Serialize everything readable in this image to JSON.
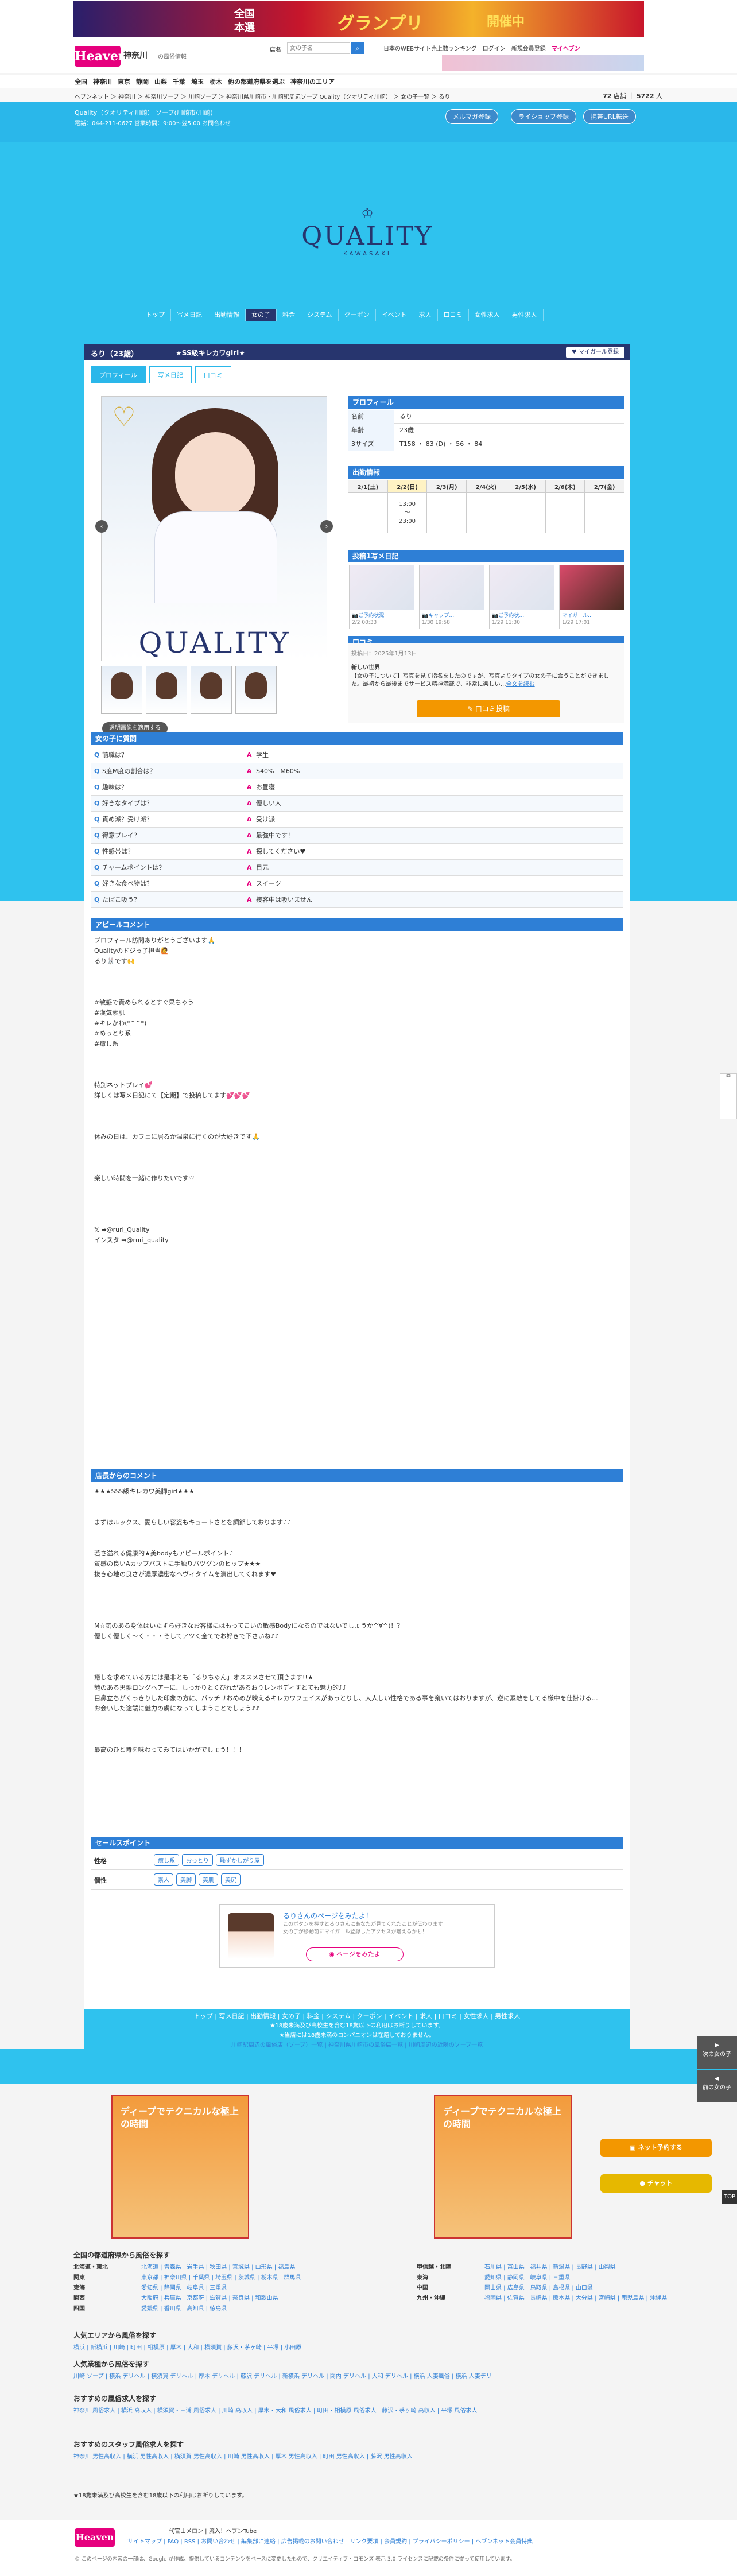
{
  "top_banner": {
    "text1": "全国",
    "text2": "本選",
    "text3": "グランプリ",
    "text4": "開催中"
  },
  "header": {
    "logo": "Heaven",
    "region": "神奈川",
    "region_sub": "の風俗情報",
    "search_placeholder": "女の子名",
    "search_label": "店名",
    "links": [
      "日本のWEBサイト売上数ランキング",
      "ログイン",
      "新規会員登録",
      "マイヘブン"
    ]
  },
  "nav": [
    "全国",
    "神奈川",
    "東京",
    "静岡",
    "山梨",
    "千葉",
    "埼玉",
    "栃木",
    "他の都道府県を選ぶ",
    "神奈川のエリア"
  ],
  "breadcrumb": "ヘブンネット ＞ 神奈川 ＞ 神奈川ソープ ＞ 川崎ソープ ＞ 神奈川県川崎市・川崎駅周辺ソープ Quality（クオリティ川崎） ＞ 女の子一覧 ＞ るり",
  "crumb_right": {
    "a": "72",
    "a_label": "店舗",
    "b": "5722",
    "b_label": "人"
  },
  "shop_bar": {
    "title": "Quality（クオリティ川崎） ソープ(川崎市/川崎)",
    "info": "電話：044-211-0627  営業時間：9:00〜翌5:00  お問合わせ",
    "pills": [
      "メルマガ登録",
      "ライショップ登録",
      "携帯URL転送"
    ]
  },
  "hero": {
    "logo": "QUALITY",
    "logo_sub": "KAWASAKI"
  },
  "shop_nav": [
    "トップ",
    "写メ日記",
    "出勤情報",
    "女の子",
    "料金",
    "システム",
    "クーポン",
    "イベント",
    "求人",
    "口コミ",
    "女性求人",
    "男性求人"
  ],
  "profile": {
    "name": "るり（23歳）",
    "tagline": "★SS級キレカワgirl★",
    "my_girl_btn": "マイガール登録",
    "tabs": [
      "プロフィール",
      "写メ日記",
      "口コミ"
    ],
    "photo_watermark": "QUALITY",
    "grad_btn": "透明画像を適用する",
    "prev": "‹",
    "next": "›"
  },
  "prof_table": {
    "header": "プロフィール",
    "rows": [
      {
        "k": "名前",
        "v": "るり"
      },
      {
        "k": "年齢",
        "v": "23歳"
      },
      {
        "k": "3サイズ",
        "v": "T158 ・ 83 (D) ・ 56 ・ 84"
      }
    ]
  },
  "schedule": {
    "header": "出勤情報",
    "days": [
      "2/1(土)",
      "2/2(日)",
      "2/3(月)",
      "2/4(火)",
      "2/5(水)",
      "2/6(木)",
      "2/7(金)"
    ],
    "times": [
      "",
      "13:00\n〜\n23:00",
      "",
      "",
      "",
      "",
      ""
    ]
  },
  "diary": {
    "header": "投稿1写メ日記",
    "items": [
      {
        "title": "📷ご予約状況",
        "date": "2/2 00:33"
      },
      {
        "title": "📷キャップ…",
        "date": "1/30 19:58"
      },
      {
        "title": "📷ご予約状…",
        "date": "1/29 11:30"
      },
      {
        "title": "マイガール…",
        "date": "1/29 17:01"
      }
    ]
  },
  "kuchikomi": {
    "header": "口コミ",
    "date": "投稿日：2025年1月13日",
    "title": "新しい世界",
    "body": "【女の子について】写真を見て指名をしたのですが、写真よりタイプの女の子に会うことができました。最初から最後までサービス精神満載で、非常に楽しい…",
    "more": "全文を読む",
    "post_btn": "口コミ投稿"
  },
  "qa": {
    "header": "女の子に質問",
    "items": [
      {
        "q": "前職は？",
        "a": "学生"
      },
      {
        "q": "S度M度の割合は？",
        "a": "S40%　M60%"
      },
      {
        "q": "趣味は？",
        "a": "お昼寝"
      },
      {
        "q": "好きなタイプは？",
        "a": "優しい人"
      },
      {
        "q": "責め派？受け派？",
        "a": "受け派"
      },
      {
        "q": "得意プレイ？",
        "a": "最強中です！"
      },
      {
        "q": "性感帯は？",
        "a": "探してください♥"
      },
      {
        "q": "チャームポイントは？",
        "a": "目元"
      },
      {
        "q": "好きな食べ物は？",
        "a": "スイーツ"
      },
      {
        "q": "たばこ吸う？",
        "a": "接客中は吸いません"
      }
    ]
  },
  "appeal": {
    "header": "アピールコメント",
    "body": "プロフィール訪問ありがとうございます🙏\nQualityのドジっ子担当🙋\nるり🐰です🙌\n\n\n\n#敏感で責められるとすぐ果ちゃう\n#漢気素肌\n#キレかわ(*^^*)\n#めっとり系\n#癒し系\n\n\n\n特別ネットプレイ💕\n詳しくは写メ日記にて【定期】で投稿してます💕💕💕\n\n\n\n休みの日は、カフェに居るか温泉に行くのが大好きです🙏\n\n\n\n楽しい時間を一緒に作りたいです♡\n\n\n\n\n𝕏 ➡@ruri_Quality\nインスタ ➡@ruri_quality"
  },
  "shop_comment": {
    "header": "店長からのコメント",
    "body": "★★★SSS級キレカワ美脚girl★★★\n\n\nまずはルックス、愛らしい容姿もキュートさとを調節しております♪♪\n\n\n若さ溢れる健康的★美bodyもアピールポイント♪\n質感の良いAカップバストに手触りバツグンのヒップ★★★\n抜き心地の良さが濃厚濃密なヘヴィタイムを演出してくれます♥\n\n\n\n\nM☆気のある身体はいたずら好きなお客様にはもってこいの敏感Bodyになるのではないでしょうか^∀^)！？\n優しく優しく〜く・・・そしてアツく全てでお好きで下さいね♪♪\n\n\n\n癒しを求めている方には是非とも「るりちゃん」オススメさせて頂きます!!★\n艶のある黒髪ロングヘアーに、しっかりとくびれがあるおりレンボディすとても魅力的♪♪\n目鼻立ちがくっきりした印象の方に、パッチリおめめが映えるキレカワフェイスがあっとりし、大人しい性格である事を窺いてはおりますが、逆に素敵をしてる様中を仕掛ける…\nお会いした途端に魅力の虜になってしまうことでしょう♪♪\n\n\n\n最高のひと時を味わってみてはいかがでしょう！！！"
  },
  "sales_point": {
    "header": "セールスポイント",
    "rows": [
      {
        "k": "性格",
        "tags": [
          "癒し系",
          "おっとり",
          "恥ずかしがり屋"
        ]
      },
      {
        "k": "個性",
        "tags": [
          "素人",
          "美脚",
          "美肌",
          "美尻"
        ]
      }
    ]
  },
  "visit": {
    "title": "るりさんのページをみたよ！",
    "sub": "このボタンを押すとるりさんにあなたが見てくれたことが伝わります\n女の子が移動前にマイガール登録したアクセスが増えるかも！",
    "btn": "ページをみたよ"
  },
  "footer_nav": {
    "links": "トップ | 写メ日記 | 出勤情報 | 女の子 | 料金 | システム | クーポン | イベント | 求人 | 口コミ | 女性求人 | 男性求人",
    "note1": "★18歳未満及び高校生を含む18歳以下の利用はお断りしています。",
    "note2": "★当店には18歳未満のコンパニオンは在籍しておりません。",
    "links2": "川崎駅周辺の風俗店（ソープ）一覧  |  神奈川県川崎市の風俗店一覧  |  川崎周辺の近隣のソープ一覧"
  },
  "ads": {
    "text": "ディープでテクニカルな極上の時間"
  },
  "footer_lists": {
    "region_header": "全国の都道府県から風俗を探す",
    "regions": [
      {
        "p": "北海道・東北",
        "l": "北海道 | 青森県 | 岩手県 | 秋田県 | 宮城県 | 山形県 | 福島県"
      },
      {
        "p": "関東",
        "l": "東京都 | 神奈川県 | 千葉県 | 埼玉県 | 茨城県 | 栃木県 | 群馬県"
      },
      {
        "p": "東海",
        "l": "愛知県 | 静岡県 | 岐阜県 | 三重県"
      },
      {
        "p": "関西",
        "l": "大阪府 | 兵庫県 | 京都府 | 滋賀県 | 奈良県 | 和歌山県"
      },
      {
        "p": "四国",
        "l": "愛媛県 | 香川県 | 高知県 | 徳島県"
      }
    ],
    "regions_r": [
      {
        "p": "甲信越・北陸",
        "l": "石川県 | 富山県 | 福井県 | 新潟県 | 長野県 | 山梨県"
      },
      {
        "p": "東海",
        "l": "愛知県 | 静岡県 | 岐阜県 | 三重県"
      },
      {
        "p": "中国",
        "l": "岡山県 | 広島県 | 鳥取県 | 島根県 | 山口県"
      },
      {
        "p": "九州・沖縄",
        "l": "福岡県 | 佐賀県 | 長崎県 | 熊本県 | 大分県 | 宮崎県 | 鹿児島県 | 沖縄県"
      }
    ],
    "area_header": "人気エリアから風俗を探す",
    "area": "横浜 | 新横浜 | 川崎 | 町田 | 相模原 | 厚木 | 大和 | 横須賀 | 藤沢・茅ヶ崎 | 平塚 | 小田原",
    "type_header": "人気業種から風俗を探す",
    "types": "川崎 ソープ | 横浜 デリヘル | 横須賀 デリヘル | 厚木 デリヘル | 藤沢 デリヘル | 新横浜 デリヘル | 関内 デリヘル | 大和 デリヘル | 横浜 人妻風俗 | 横浜 人妻デリ",
    "rec_header": "おすすめの風俗求人を探す",
    "rec": "神奈川 風俗求人 | 横浜 高収入 | 横須賀・三浦 風俗求人 | 川崎 高収入 | 厚木・大和 風俗求人 | 町田・相模原 風俗求人 | 藤沢・茅ヶ崎 高収入 | 平塚 風俗求人",
    "rec2_header": "おすすめのスタッフ風俗求人を探す",
    "rec2": "神奈川 男性高収入 | 横浜 男性高収入 | 横須賀 男性高収入 | 川崎 男性高収入 | 厚木 男性高収入 | 町田 男性高収入 | 藤沢 男性高収入",
    "note": "★18歳未満及び高校生を含む18歳以下の利用はお断りしています。"
  },
  "footer": {
    "logo": "Heaven",
    "links": "サイトマップ | FAQ | RSS | お問い合わせ | 編集部に連絡 | 広告掲載のお問い合わせ | リンク要項 | 会員規約 | プライバシーポリシー | ヘブンネット会員特典",
    "copy": "© このページの内容の一部は、Google が作成、提供しているコンテンツをベースに変更したもので、クリエイティブ・コモンズ 表示 3.0 ライセンスに記載の条件に従って使用しています。",
    "app": "代官山メロン  |  流入！ヘブンTube"
  },
  "side": {
    "next": "次の女の子",
    "prev": "前の女の子",
    "top": "TOP",
    "chip1": "マイガール登録",
    "chip2": "チャット",
    "chip1_sub": "ネット予約する"
  }
}
